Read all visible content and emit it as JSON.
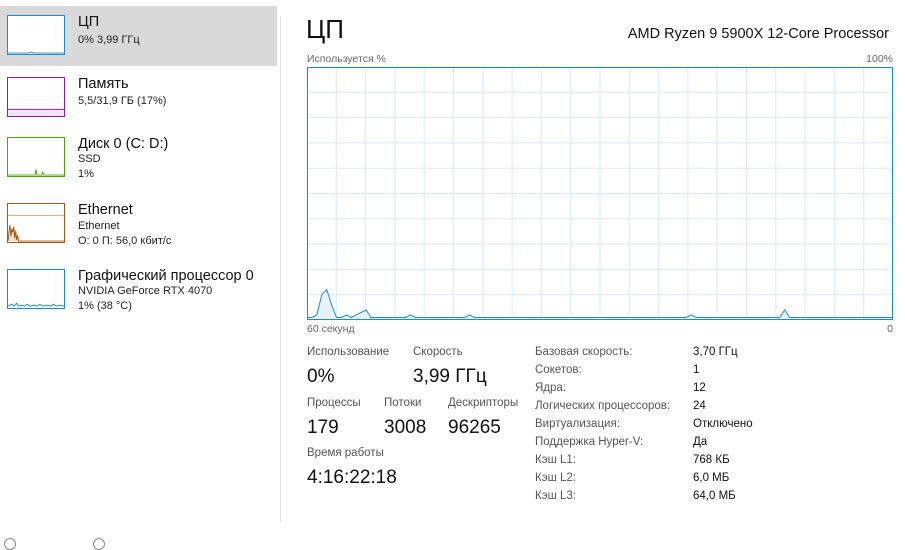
{
  "sidebar": {
    "items": [
      {
        "title": "ЦП",
        "sub1": "0%  3,99 ГГц",
        "sub2": "",
        "color": "#1a8ccf",
        "selected": true
      },
      {
        "title": "Память",
        "sub1": "5,5/31,9 ГБ (17%)",
        "sub2": "",
        "color": "#8b1fa9",
        "selected": false
      },
      {
        "title": "Диск 0 (C: D:)",
        "sub1": "SSD",
        "sub2": "1%",
        "color": "#4da60c",
        "selected": false
      },
      {
        "title": "Ethernet",
        "sub1": "Ethernet",
        "sub2": "О: 0 П: 56,0 кбит/с",
        "color": "#a7561c",
        "selected": false
      },
      {
        "title": "Графический процессор 0",
        "sub1": "NVIDIA GeForce RTX 4070",
        "sub2": "1%  (38 °C)",
        "color": "#1a8ccf",
        "selected": false
      }
    ]
  },
  "main": {
    "title": "ЦП",
    "cpu_model": "AMD Ryzen 9 5900X 12-Core Processor",
    "graph": {
      "label_top_left": "Используется %",
      "label_top_right": "100%",
      "label_bottom_left": "60 секунд",
      "label_bottom_right": "0",
      "line_color": "#1a8ccf",
      "grid_color": "#d9eaf7",
      "usage_percent": [
        1,
        1,
        2,
        10,
        12,
        6,
        1,
        1,
        2,
        1,
        2,
        3,
        4,
        1,
        1,
        1,
        1,
        1,
        1,
        1,
        1,
        2,
        1,
        1,
        1,
        1,
        1,
        1,
        1,
        1,
        1,
        1,
        1,
        2,
        1,
        1,
        1,
        1,
        1,
        1,
        1,
        1,
        1,
        1,
        1,
        1,
        1,
        1,
        1,
        1,
        1,
        1,
        1,
        1,
        1,
        1,
        1,
        1,
        1,
        1,
        1,
        1,
        1,
        1,
        1,
        1,
        1,
        1,
        1,
        1,
        1,
        1,
        1,
        1,
        1,
        1,
        1,
        1,
        2,
        1,
        1,
        1,
        1,
        1,
        1,
        1,
        1,
        1,
        1,
        1,
        1,
        1,
        1,
        1,
        1,
        1,
        1,
        4,
        1,
        1,
        1,
        1,
        1,
        1,
        1,
        1,
        1,
        1,
        1,
        1,
        1,
        1,
        1,
        1,
        1,
        1,
        1,
        1,
        1,
        1
      ]
    },
    "stats": {
      "usage_label": "Использование",
      "usage_value": "0%",
      "speed_label": "Скорость",
      "speed_value": "3,99 ГГц",
      "processes_label": "Процессы",
      "processes_value": "179",
      "threads_label": "Потоки",
      "threads_value": "3008",
      "handles_label": "Дескрипторы",
      "handles_value": "96265",
      "uptime_label": "Время работы",
      "uptime_value": "4:16:22:18"
    },
    "specs": [
      {
        "key": "Базовая скорость:",
        "value": "3,70 ГГц"
      },
      {
        "key": "Сокетов:",
        "value": "1"
      },
      {
        "key": "Ядра:",
        "value": "12"
      },
      {
        "key": "Логических процессоров:",
        "value": "24"
      },
      {
        "key": "Виртуализация:",
        "value": "Отключено"
      },
      {
        "key": "Поддержка Hyper-V:",
        "value": "Да"
      },
      {
        "key": "Кэш L1:",
        "value": "768 КБ"
      },
      {
        "key": "Кэш L2:",
        "value": "6,0 МБ"
      },
      {
        "key": "Кэш L3:",
        "value": "64,0 МБ"
      }
    ]
  }
}
